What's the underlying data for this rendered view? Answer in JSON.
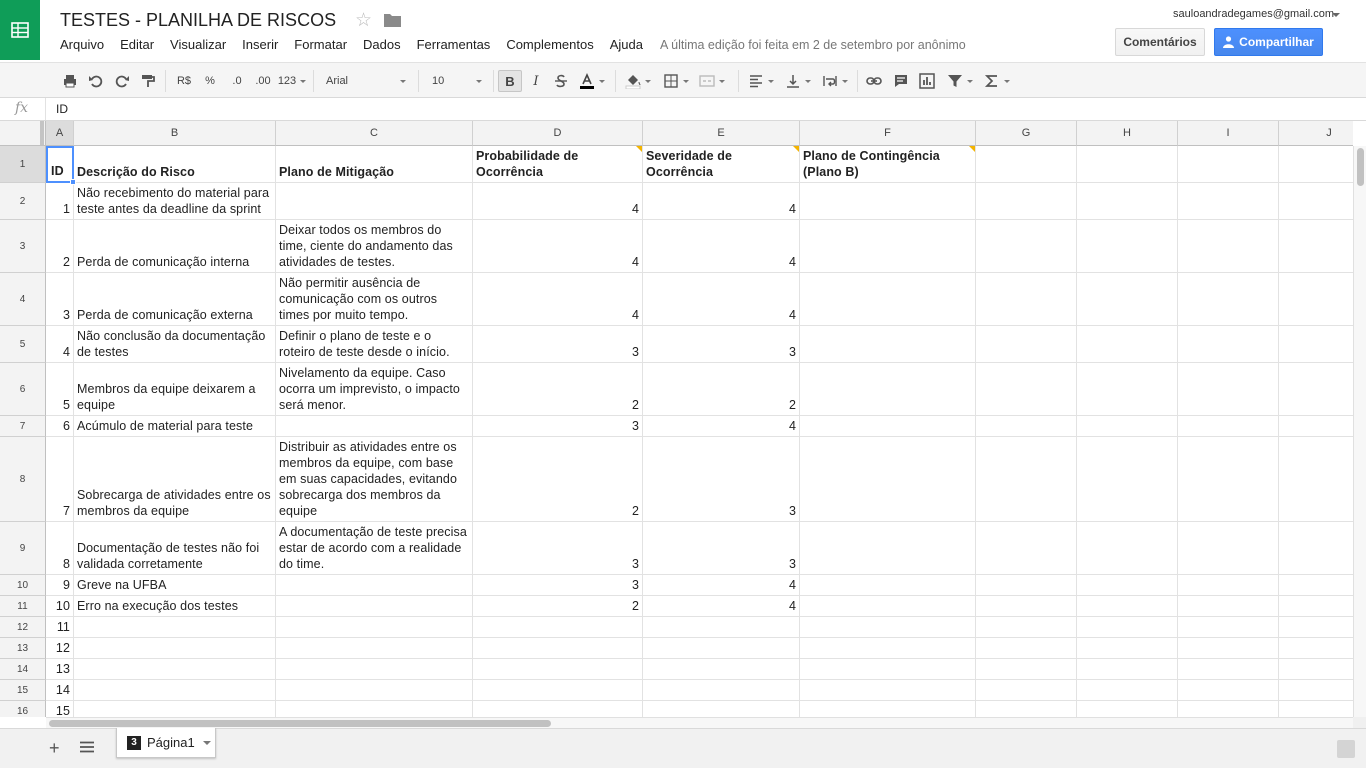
{
  "doc": {
    "title": "TESTES - PLANILHA DE RISCOS",
    "last_edit": "A última edição foi feita em 2 de setembro por anônimo"
  },
  "account": {
    "email": "sauloandradegames@gmail.com"
  },
  "buttons": {
    "comments": "Comentários",
    "share": "Compartilhar"
  },
  "menu": [
    "Arquivo",
    "Editar",
    "Visualizar",
    "Inserir",
    "Formatar",
    "Dados",
    "Ferramentas",
    "Complementos",
    "Ajuda"
  ],
  "toolbar": {
    "currency": "R$",
    "percent": "%",
    "dec_decrease": ".0",
    "dec_increase": ".00",
    "more_formats": "123",
    "font": "Arial",
    "font_size": "10",
    "bold": "B",
    "italic": "I"
  },
  "formula": {
    "label": "fx",
    "value": "ID"
  },
  "grid": {
    "columns": [
      "A",
      "B",
      "C",
      "D",
      "E",
      "F",
      "G",
      "H",
      "I",
      "J"
    ],
    "rows": [
      [
        "ID",
        "Descrição do Risco",
        "Plano de Mitigação",
        "Probabilidade de Ocorrência",
        "Severidade de Ocorrência",
        "Plano de Contingência (Plano B)"
      ],
      [
        "1",
        "Não recebimento do material para teste antes da deadline da sprint",
        "",
        "4",
        "4",
        ""
      ],
      [
        "2",
        "Perda de comunicação interna",
        "Deixar todos os membros do time, ciente do andamento das atividades de testes.",
        "4",
        "4",
        ""
      ],
      [
        "3",
        "Perda de comunicação externa",
        "Não permitir ausência de comunicação com os outros times por muito tempo.",
        "4",
        "4",
        ""
      ],
      [
        "4",
        "Não conclusão da documentação de testes",
        "Definir o plano de teste e o roteiro de teste desde o início.",
        "3",
        "3",
        ""
      ],
      [
        "5",
        "Membros da equipe deixarem a equipe",
        "Nivelamento da equipe. Caso ocorra um imprevisto, o impacto será menor.",
        "2",
        "2",
        ""
      ],
      [
        "6",
        "Acúmulo de material para teste",
        "",
        "3",
        "4",
        ""
      ],
      [
        "7",
        "Sobrecarga de atividades entre os membros da equipe",
        "Distribuir as atividades entre os membros da equipe, com base em suas capacidades, evitando sobrecarga dos membros da equipe",
        "2",
        "3",
        ""
      ],
      [
        "8",
        "Documentação de testes não foi validada corretamente",
        "A documentação de teste precisa estar de acordo com a realidade do time.",
        "3",
        "3",
        ""
      ],
      [
        "9",
        "Greve na UFBA",
        "",
        "3",
        "4",
        ""
      ],
      [
        "10",
        "Erro na execução dos testes",
        "",
        "2",
        "4",
        ""
      ],
      [
        "11",
        "",
        "",
        "",
        "",
        ""
      ],
      [
        "12",
        "",
        "",
        "",
        "",
        ""
      ],
      [
        "13",
        "",
        "",
        "",
        "",
        ""
      ],
      [
        "14",
        "",
        "",
        "",
        "",
        ""
      ],
      [
        "15",
        "",
        "",
        "",
        "",
        ""
      ]
    ]
  },
  "sheet_tab": {
    "badge": "3",
    "name": "Página1"
  },
  "colors": {
    "brand_green": "#0f9d58",
    "share_blue": "#4d90fe",
    "selection_blue": "#4d90fe",
    "note_marker": "#f4b400"
  }
}
